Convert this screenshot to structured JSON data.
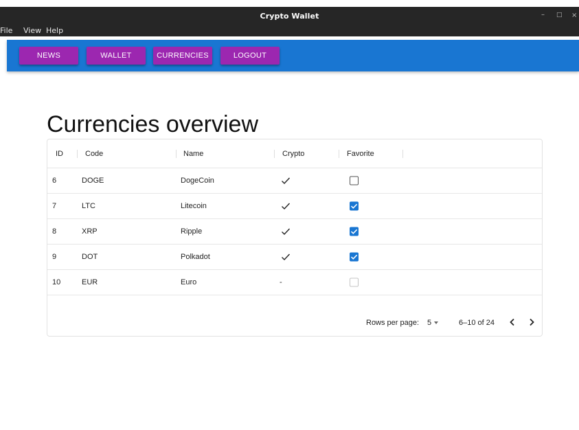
{
  "window": {
    "title": "Crypto Wallet",
    "controls": {
      "minimize": "–",
      "maximize": "□",
      "close": "×"
    }
  },
  "menu": {
    "items": [
      {
        "label": "File"
      },
      {
        "label": "View"
      },
      {
        "label": "Help"
      }
    ]
  },
  "nav": {
    "buttons": [
      {
        "label": "NEWS"
      },
      {
        "label": "WALLET"
      },
      {
        "label": "CURRENCIES"
      },
      {
        "label": "LOGOUT"
      }
    ],
    "bar_color": "#1976d2",
    "button_color": "#9c27b0"
  },
  "page": {
    "title": "Currencies overview"
  },
  "table": {
    "columns": [
      "ID",
      "Code",
      "Name",
      "Crypto",
      "Favorite"
    ],
    "rows": [
      {
        "id": "6",
        "code": "DOGE",
        "name": "DogeCoin",
        "crypto": true,
        "crypto_text": "",
        "favorite": "unchecked"
      },
      {
        "id": "7",
        "code": "LTC",
        "name": "Litecoin",
        "crypto": true,
        "crypto_text": "",
        "favorite": "checked"
      },
      {
        "id": "8",
        "code": "XRP",
        "name": "Ripple",
        "crypto": true,
        "crypto_text": "",
        "favorite": "checked"
      },
      {
        "id": "9",
        "code": "DOT",
        "name": "Polkadot",
        "crypto": true,
        "crypto_text": "",
        "favorite": "checked"
      },
      {
        "id": "10",
        "code": "EUR",
        "name": "Euro",
        "crypto": false,
        "crypto_text": "-",
        "favorite": "disabled"
      }
    ],
    "pagination": {
      "rows_per_page_label": "Rows per page:",
      "rows_per_page": "5",
      "range": "6–10 of 24",
      "prev_icon": "chevron-left-icon",
      "next_icon": "chevron-right-icon"
    },
    "check_color": "#1976d2"
  }
}
